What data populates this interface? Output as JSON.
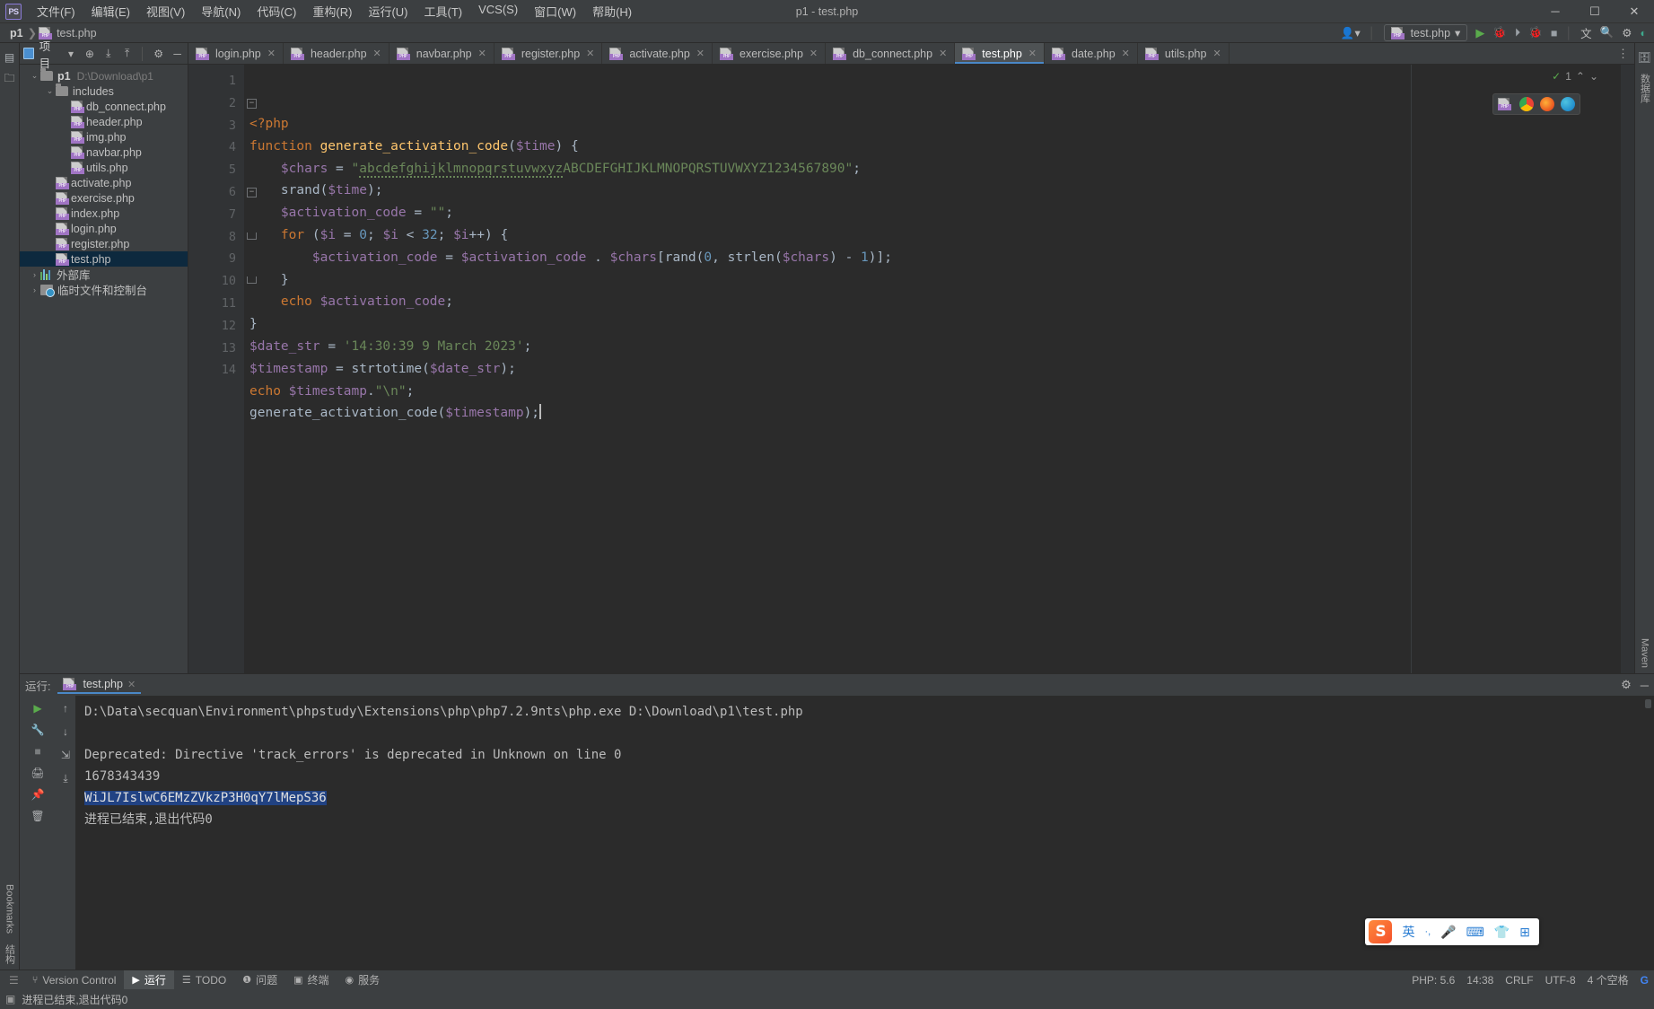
{
  "titlebar": {
    "logo": "PS",
    "menus": [
      "文件(F)",
      "编辑(E)",
      "视图(V)",
      "导航(N)",
      "代码(C)",
      "重构(R)",
      "运行(U)",
      "工具(T)",
      "VCS(S)",
      "窗口(W)",
      "帮助(H)"
    ],
    "window_title": "p1 - test.php",
    "minimize": "─",
    "maximize": "☐",
    "close": "✕"
  },
  "breadcrumb": {
    "project": "p1",
    "separator": "❯",
    "file": "test.php"
  },
  "left_strip": {
    "project_label": "项目",
    "bookmarks_label": "Bookmarks",
    "structure_label": "结构"
  },
  "project_panel": {
    "title": "项目",
    "dropdown": "▾",
    "root": {
      "name": "p1",
      "path": "D:\\Download\\p1"
    },
    "tree": [
      {
        "label": "includes",
        "type": "folder",
        "depth": 1,
        "expanded": true
      },
      {
        "label": "db_connect.php",
        "type": "php",
        "depth": 2
      },
      {
        "label": "header.php",
        "type": "php",
        "depth": 2
      },
      {
        "label": "img.php",
        "type": "php",
        "depth": 2
      },
      {
        "label": "navbar.php",
        "type": "php",
        "depth": 2
      },
      {
        "label": "utils.php",
        "type": "php",
        "depth": 2
      },
      {
        "label": "activate.php",
        "type": "php",
        "depth": 1
      },
      {
        "label": "exercise.php",
        "type": "php",
        "depth": 1
      },
      {
        "label": "index.php",
        "type": "php",
        "depth": 1
      },
      {
        "label": "login.php",
        "type": "php",
        "depth": 1
      },
      {
        "label": "register.php",
        "type": "php",
        "depth": 1
      },
      {
        "label": "test.php",
        "type": "php",
        "depth": 1,
        "selected": true
      },
      {
        "label": "外部库",
        "type": "library",
        "depth": 0
      },
      {
        "label": "临时文件和控制台",
        "type": "scratch",
        "depth": 0
      }
    ]
  },
  "editor_tabs": [
    {
      "label": "login.php",
      "active": false
    },
    {
      "label": "header.php",
      "active": false
    },
    {
      "label": "navbar.php",
      "active": false
    },
    {
      "label": "register.php",
      "active": false
    },
    {
      "label": "activate.php",
      "active": false
    },
    {
      "label": "exercise.php",
      "active": false
    },
    {
      "label": "db_connect.php",
      "active": false
    },
    {
      "label": "test.php",
      "active": true
    },
    {
      "label": "date.php",
      "active": false
    },
    {
      "label": "utils.php",
      "active": false
    }
  ],
  "run_config": {
    "file": "test.php",
    "dropdown": "▾"
  },
  "toolbar_right": {
    "run": "▶",
    "debug": "🐞",
    "coverage": "⏵",
    "profile": "🐞",
    "stop": "■",
    "translate": "文A",
    "search": "🔍",
    "settings": "⚙",
    "update": "◐",
    "user": "👤"
  },
  "inspections": {
    "count": "1",
    "ok": "✓"
  },
  "code": {
    "lines": [
      {
        "n": 1,
        "fold": "",
        "html": "<span class=\"kw\">&lt;?php</span>"
      },
      {
        "n": 2,
        "fold": "-",
        "html": "<span class=\"kw\">function</span> <span class=\"fn\">generate_activation_code</span><span class=\"def\">(</span><span class=\"var\">$time</span><span class=\"def\">) {</span>"
      },
      {
        "n": 3,
        "fold": "",
        "html": "    <span class=\"var\">$chars</span> <span class=\"def\">=</span> <span class=\"str\">\"</span><span class=\"str typo\">abcdefghijklmnopqrstuvwxyz</span><span class=\"str\">ABCDEFGHIJKLMNOPQRSTUVWXYZ1234567890\"</span><span class=\"def\">;</span>"
      },
      {
        "n": 4,
        "fold": "",
        "html": "    <span class=\"def\">srand(</span><span class=\"var\">$time</span><span class=\"def\">);</span>"
      },
      {
        "n": 5,
        "fold": "",
        "html": "    <span class=\"var\">$activation_code</span> <span class=\"def\">=</span> <span class=\"str\">\"\"</span><span class=\"def\">;</span>"
      },
      {
        "n": 6,
        "fold": "-",
        "html": "    <span class=\"kw\">for</span> <span class=\"def\">(</span><span class=\"var\">$i</span> <span class=\"def\">=</span> <span class=\"num\">0</span><span class=\"def\">;</span> <span class=\"var\">$i</span> <span class=\"def\">&lt;</span> <span class=\"num\">32</span><span class=\"def\">;</span> <span class=\"var\">$i</span><span class=\"def\">++) {</span>"
      },
      {
        "n": 7,
        "fold": "",
        "html": "        <span class=\"var\">$activation_code</span> <span class=\"def\">=</span> <span class=\"var\">$activation_code</span> <span class=\"def\">.</span> <span class=\"var\">$chars</span><span class=\"def\">[rand(</span><span class=\"num\">0</span><span class=\"def\">, strlen(</span><span class=\"var\">$chars</span><span class=\"def\">) - </span><span class=\"num\">1</span><span class=\"def\">)];</span>"
      },
      {
        "n": 8,
        "fold": "⌄",
        "html": "    <span class=\"def\">}</span>"
      },
      {
        "n": 9,
        "fold": "",
        "html": "    <span class=\"kw\">echo</span> <span class=\"var\">$activation_code</span><span class=\"def\">;</span>"
      },
      {
        "n": 10,
        "fold": "⌄",
        "html": "<span class=\"def\">}</span>"
      },
      {
        "n": 11,
        "fold": "",
        "html": "<span class=\"var\">$date_str</span> <span class=\"def\">=</span> <span class=\"str\">'14:30:39 9 March 2023'</span><span class=\"def\">;</span>"
      },
      {
        "n": 12,
        "fold": "",
        "html": "<span class=\"var\">$timestamp</span> <span class=\"def\">=</span> <span class=\"def\">strtotime(</span><span class=\"var\">$date_str</span><span class=\"def\">);</span>"
      },
      {
        "n": 13,
        "fold": "",
        "html": "<span class=\"kw\">echo</span> <span class=\"var\">$timestamp</span><span class=\"def\">.</span><span class=\"str\">\"\\n\"</span><span class=\"def\">;</span>"
      },
      {
        "n": 14,
        "fold": "",
        "html": "<span class=\"def\">generate_activation_code(</span><span class=\"var\">$timestamp</span><span class=\"def\">);</span><span id=\"caret\"></span>"
      }
    ]
  },
  "run_panel": {
    "label": "运行:",
    "tab": "test.php",
    "settings_icon": "⚙",
    "minimize_icon": "─",
    "output": [
      {
        "text": "D:\\Data\\secquan\\Environment\\phpstudy\\Extensions\\php\\php7.2.9nts\\php.exe D:\\Download\\p1\\test.php",
        "style": "normal"
      },
      {
        "text": "",
        "style": "normal"
      },
      {
        "text": "Deprecated: Directive 'track_errors' is deprecated in Unknown on line 0",
        "style": "normal"
      },
      {
        "text": "1678343439",
        "style": "normal"
      },
      {
        "text": "WiJL7IslwC6EMzZVkzP3H0qY7lMepS36",
        "style": "selected"
      },
      {
        "text": "进程已结束,退出代码0",
        "style": "normal"
      }
    ]
  },
  "status_bar": {
    "buttons": [
      {
        "label": "Version Control",
        "icon": "branch-icon",
        "active": false
      },
      {
        "label": "运行",
        "icon": "play-icon",
        "active": true
      },
      {
        "label": "TODO",
        "icon": "list-icon",
        "active": false
      },
      {
        "label": "问题",
        "icon": "warning-icon",
        "active": false
      },
      {
        "label": "终端",
        "icon": "terminal-icon",
        "active": false
      },
      {
        "label": "服务",
        "icon": "services-icon",
        "active": false
      }
    ],
    "right": [
      "PHP: 5.6",
      "14:38",
      "CRLF",
      "UTF-8",
      "4 个空格"
    ],
    "message": "进程已结束,退出代码0"
  },
  "ime": {
    "sogou": "S",
    "lang": "英",
    "punct": "·,",
    "mic": "🎤",
    "keyboard": "⌨",
    "skin": "👕",
    "apps": "⊞"
  },
  "right_strip": {
    "database_label": "数据库",
    "maven_label": "Maven"
  },
  "colors": {
    "accent": "#4a88c7",
    "selection": "#214283",
    "tree_selection": "#0d293e",
    "editor_bg": "#2b2b2b",
    "panel_bg": "#3c3f41",
    "keyword": "#cc7832",
    "function": "#ffc66d",
    "variable": "#9876aa",
    "string": "#6a8759",
    "number": "#6897bb",
    "default_text": "#a9b7c6"
  }
}
